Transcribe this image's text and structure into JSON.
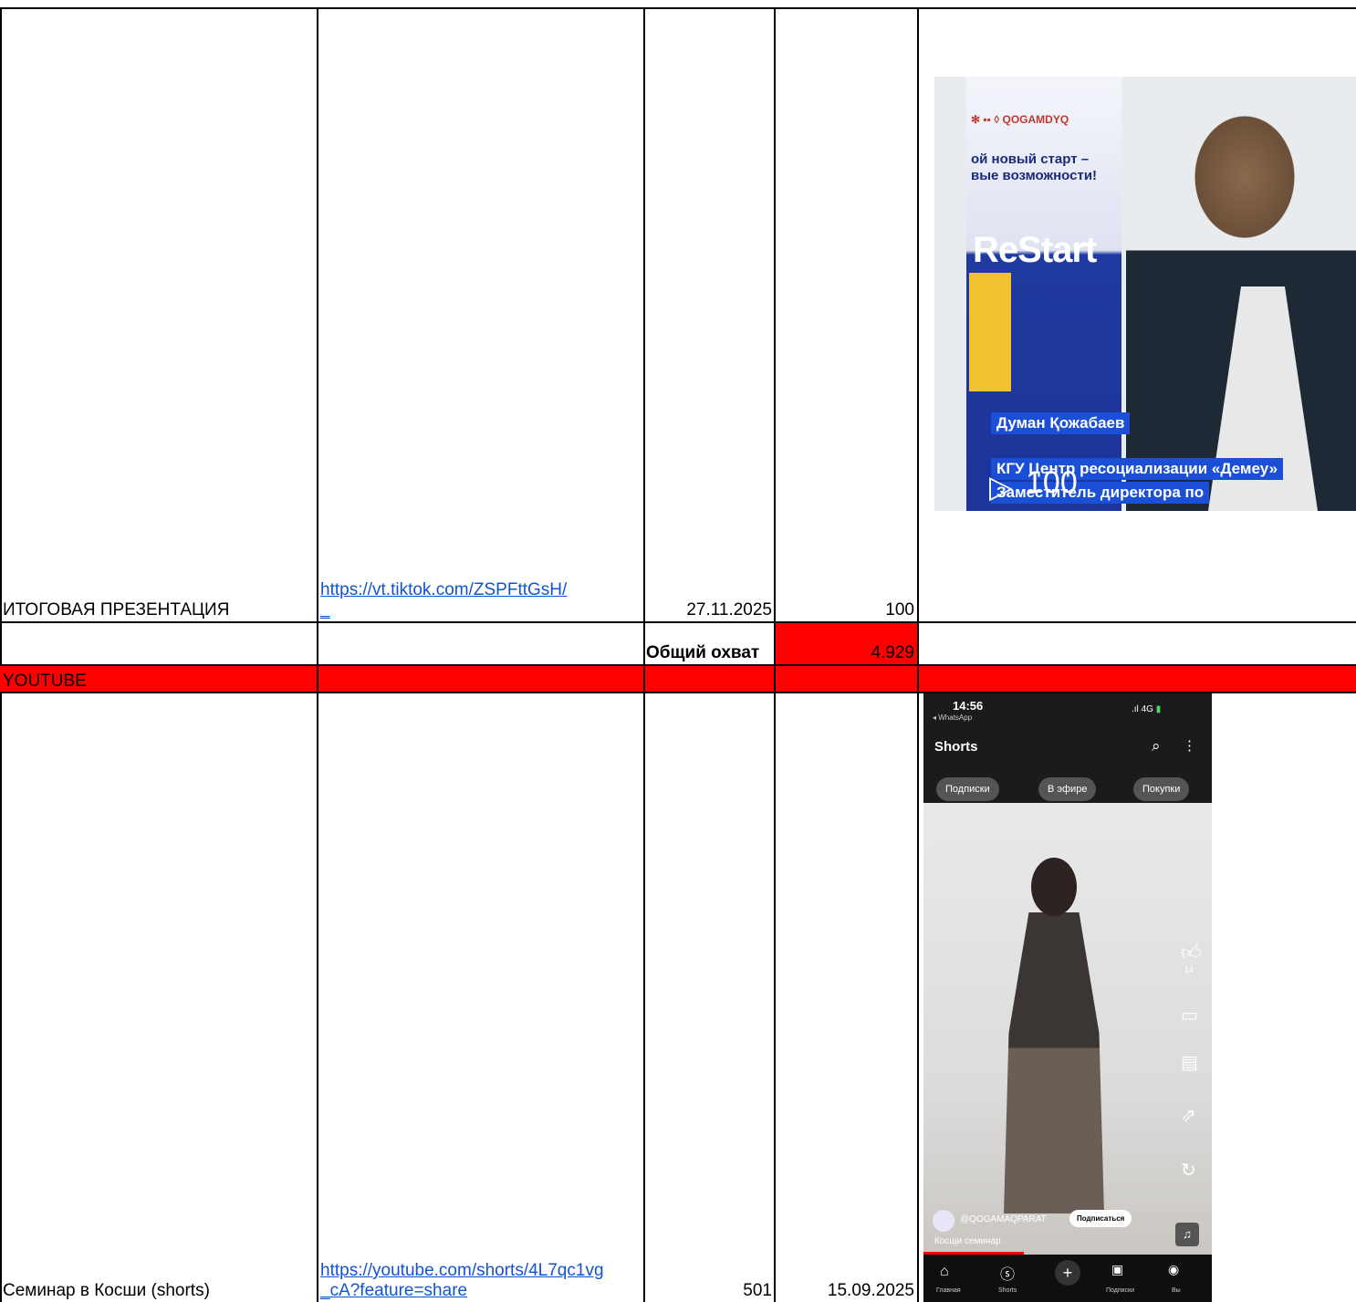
{
  "row_presentation": {
    "title": "ИТОГОВАЯ ПРЕЗЕНТАЦИЯ",
    "link_line1": "https://vt.tiktok.com/ZSPFttGsH/",
    "link_line2": "_",
    "date": "27.11.2025",
    "views": "100"
  },
  "total_row": {
    "label": "Общий охват",
    "value": "4.929"
  },
  "section_header": {
    "label": "YOUTUBE"
  },
  "row_seminar": {
    "title": "Семинар в Косши (shorts)",
    "link_line1": "https://youtube.com/shorts/4L7qc1vg",
    "link_line2": "_cA?feature=share",
    "views": "501",
    "date": "15.09.2025"
  },
  "thumbnail_tiktok": {
    "banner_line1": "ой новый старт –",
    "banner_line2": "вые возможности!",
    "banner_brand": "ReStart",
    "caption_name": "Думан Қожабаев",
    "caption_org": "КГУ Центр ресоциализации «Демеу»",
    "caption_role": "Заместитель директора по",
    "play_count": "100"
  },
  "thumbnail_youtube": {
    "time": "14:56",
    "back_app": "◂ WhatsApp",
    "signal": "4G",
    "header": "Shorts",
    "chips": [
      "Подписки",
      "В эфире",
      "Покупки"
    ],
    "likes": "14",
    "channel": "@QOGAMAQPARAT",
    "subscribe": "Подписаться",
    "video_title": "Косщи семинар",
    "nav_labels": [
      "Главная",
      "Shorts",
      "",
      "Подписки",
      "Вы"
    ]
  },
  "colors": {
    "highlight": "#ff0000",
    "link": "#1155cc",
    "grid": "#000000"
  }
}
